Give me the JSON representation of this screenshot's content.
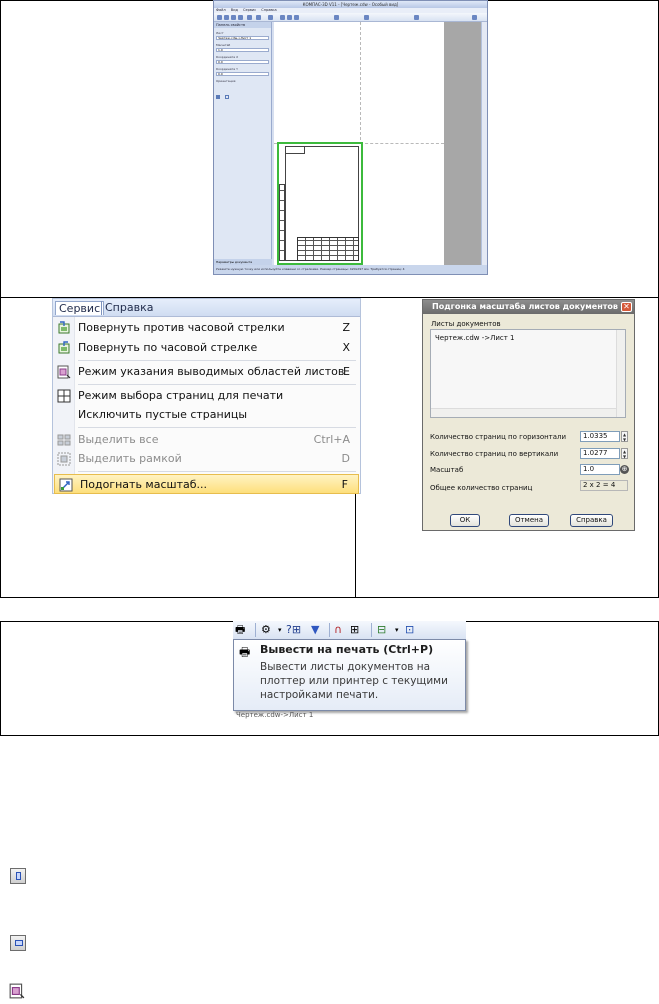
{
  "preview_window": {
    "title": "КОМПАС-3D V11 - [Чертеж.cdw - Особый вид]",
    "menu": [
      "Файл",
      "Вид",
      "Сервис",
      "Справка"
    ],
    "panel_title": "Панель свойств",
    "fields": [
      {
        "label": "Лист",
        "value": "Чертеж.cdw->Лист 1"
      },
      {
        "label": "Масштаб",
        "value": "1.0"
      },
      {
        "label": "Координата X",
        "value": "0.0"
      },
      {
        "label": "Координата Y",
        "value": "0.0"
      },
      {
        "label": "Ориентация",
        "value": ""
      }
    ],
    "panel_footer": "Параметры документа",
    "status": "Укажите нужную точку или используйте клавиши со стрелками. Размер страницы: 420x297 мм. Требуется страниц: 4"
  },
  "service_menu": {
    "menu_service": "Сервис",
    "menu_help": "Справка",
    "items": [
      {
        "label": "Повернуть против часовой стрелки",
        "key": "Z",
        "icon": "rotate-ccw-icon",
        "disabled": false
      },
      {
        "label": "Повернуть по часовой стрелке",
        "key": "X",
        "icon": "rotate-cw-icon",
        "disabled": false
      },
      {
        "label": "Режим указания выводимых областей листов",
        "key": "E",
        "icon": "sheet-area-icon",
        "disabled": false
      },
      {
        "label": "Режим выбора страниц для печати",
        "key": "",
        "icon": "page-select-icon",
        "disabled": false
      },
      {
        "label": "Исключить пустые страницы",
        "key": "",
        "icon": "",
        "disabled": false
      },
      {
        "label": "Выделить все",
        "key": "Ctrl+A",
        "icon": "select-all-icon",
        "disabled": true
      },
      {
        "label": "Выделить рамкой",
        "key": "D",
        "icon": "select-frame-icon",
        "disabled": true
      },
      {
        "label": "Подогнать масштаб...",
        "key": "F",
        "icon": "fit-scale-icon",
        "disabled": false
      }
    ]
  },
  "fit_dialog": {
    "title": "Подгонка масштаба листов документов",
    "list_label": "Листы документов",
    "list_item": "Чертеж.cdw ->Лист 1",
    "horizontal_label": "Количество страниц по горизонтали",
    "horizontal_value": "1.0335",
    "vertical_label": "Количество страниц по вертикали",
    "vertical_value": "1.0277",
    "scale_label": "Масштаб",
    "scale_value": "1.0",
    "total_label": "Общее количество страниц",
    "total_value": "2 x 2 = 4",
    "ok": "ОК",
    "cancel": "Отмена",
    "help": "Справка"
  },
  "tooltip": {
    "title": "Вывести на печать (Ctrl+P)",
    "description": "Вывести листы документов на плоттер или принтер с текущими настройками печати.",
    "underlying_text": "Чертеж.cdw->Лист 1"
  }
}
